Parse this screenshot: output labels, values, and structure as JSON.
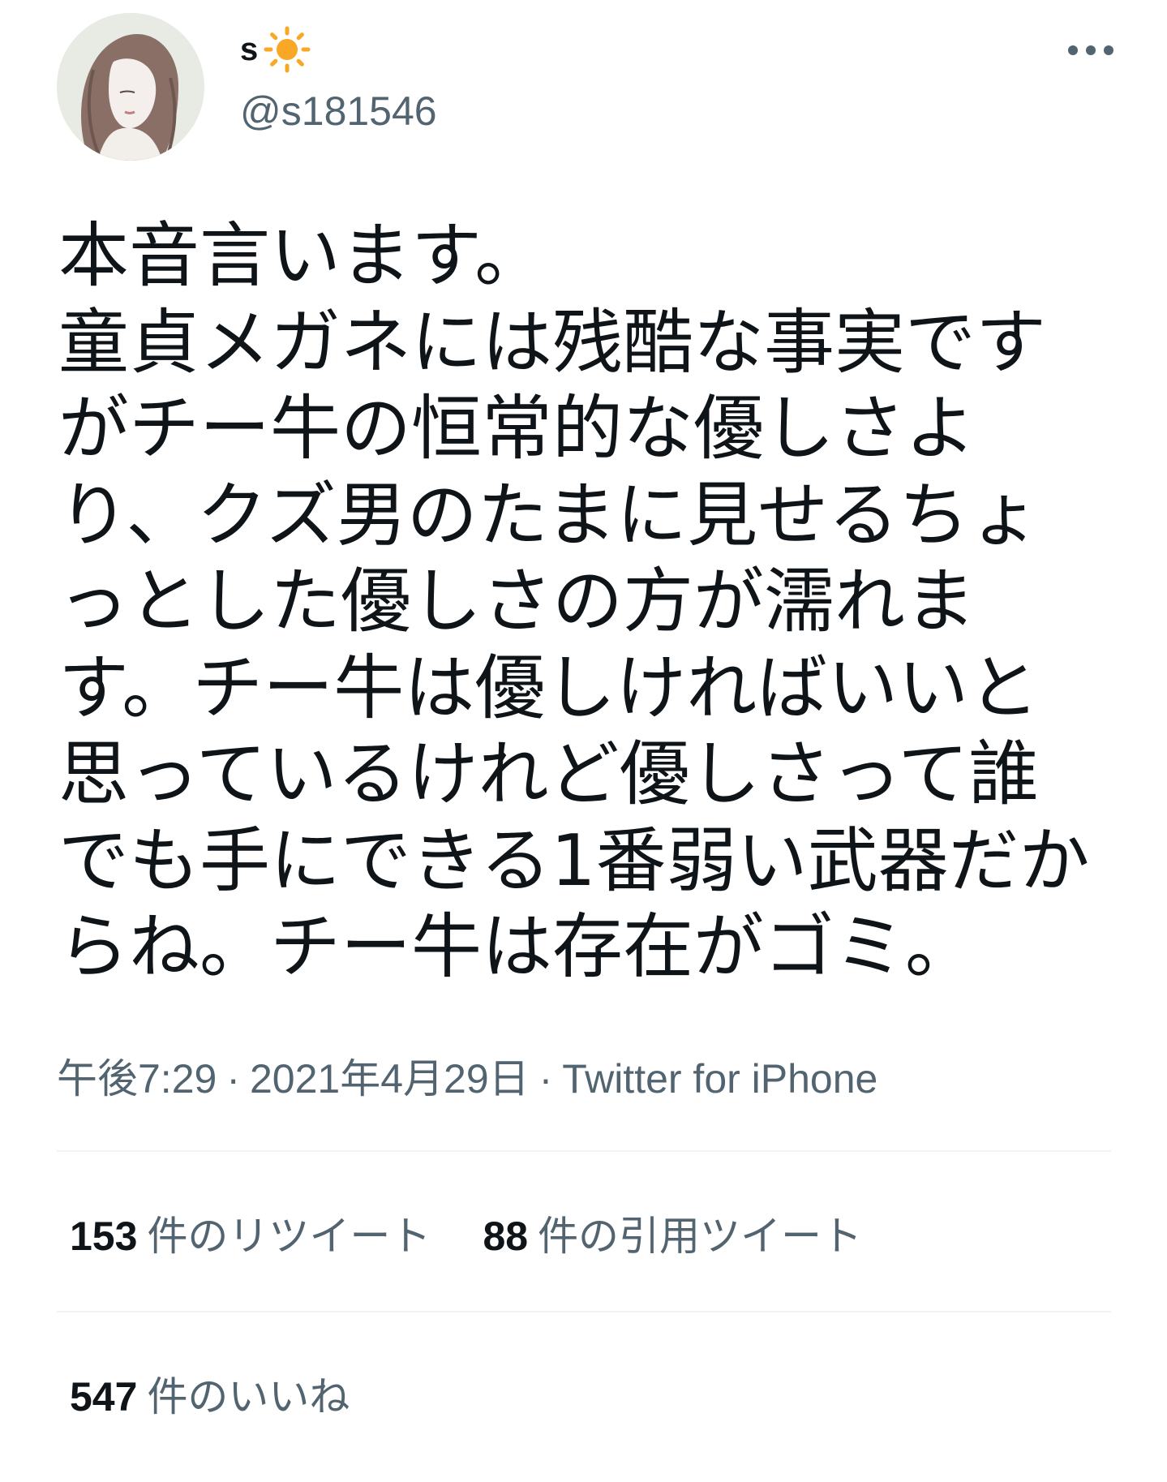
{
  "user": {
    "display_name": "s",
    "name_emoji": "sun-icon",
    "handle": "@s181546"
  },
  "tweet": {
    "lines": [
      "本音言います。",
      "童貞メガネには残酷な事実です",
      "がチー牛の恒常的な優しさよ",
      "り、クズ男のたまに見せるちょ",
      "っとした優しさの方が濡れま",
      "す。チー牛は優しければいいと",
      "思っているけれど優しさって誰",
      "でも手にできる1番弱い武器だか",
      "らね。チー牛は存在がゴミ。"
    ]
  },
  "meta": {
    "time": "午後7:29",
    "separator": "·",
    "date": "2021年4月29日",
    "source": "Twitter for iPhone"
  },
  "stats": {
    "retweets_count": "153",
    "retweets_label": "件のリツイート",
    "quotes_count": "88",
    "quotes_label": "件の引用ツイート",
    "likes_count": "547",
    "likes_label": "件のいいね"
  },
  "colors": {
    "text_primary": "#0f1419",
    "text_secondary": "#536471",
    "divider": "#eff3f4",
    "sun": "#f9a825"
  },
  "icons": {
    "more": "more-horizontal-icon",
    "avatar": "avatar"
  }
}
